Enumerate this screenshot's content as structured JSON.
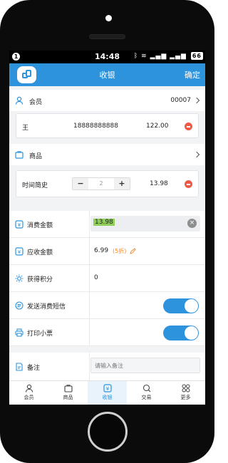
{
  "status_bar": {
    "time": "14:48",
    "notification_count": "1",
    "battery": "66"
  },
  "header": {
    "title": "收银",
    "confirm_label": "确定"
  },
  "member": {
    "label": "会员",
    "value": "00007"
  },
  "member_card": {
    "name": "王",
    "phone": "18888888888",
    "amount": "122.00"
  },
  "product": {
    "label": "商品"
  },
  "product_card": {
    "name": "时间简史",
    "quantity": "2",
    "price": "13.98"
  },
  "consume_amount": {
    "label": "消费金额",
    "value": "13.98"
  },
  "receivable_amount": {
    "label": "应收金额",
    "value": "6.99",
    "discount": "(5折)"
  },
  "points": {
    "label": "获得积分",
    "value": "0"
  },
  "send_sms": {
    "label": "发送消费短信",
    "enabled": true
  },
  "print_receipt": {
    "label": "打印小票",
    "enabled": true
  },
  "remark": {
    "label": "备注",
    "placeholder": "请输入备注"
  },
  "tabs": [
    {
      "label": "会员",
      "icon": "person-icon"
    },
    {
      "label": "商品",
      "icon": "bag-icon"
    },
    {
      "label": "收银",
      "icon": "yen-icon",
      "active": true
    },
    {
      "label": "交易",
      "icon": "search-icon"
    },
    {
      "label": "更多",
      "icon": "grid-icon"
    }
  ],
  "colors": {
    "brand": "#2e93dd",
    "danger": "#ee5a45",
    "discount": "#f08a2c",
    "highlight": "#8fcf59"
  }
}
